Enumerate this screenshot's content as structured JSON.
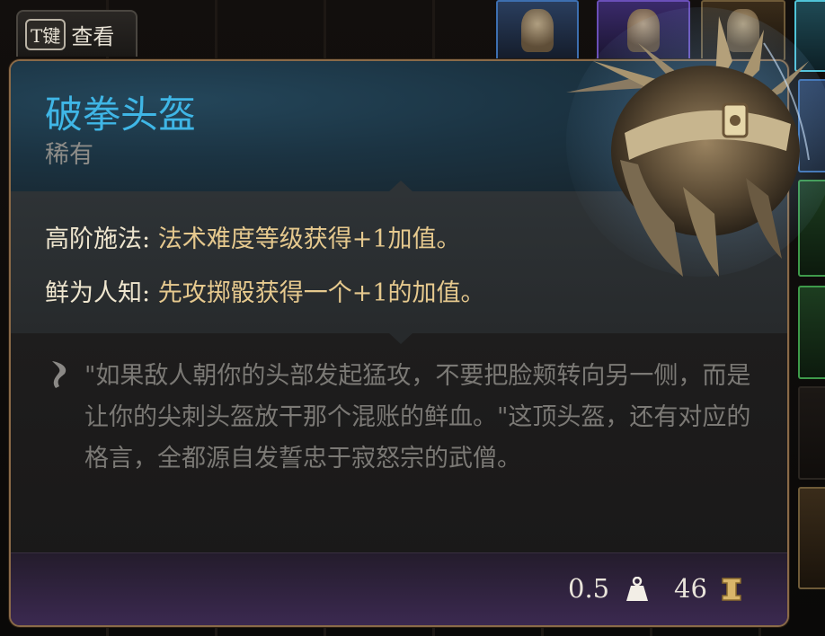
{
  "view_button": {
    "key": "T键",
    "label": "查看"
  },
  "item": {
    "name": "破拳头盔",
    "rarity": "稀有",
    "name_color": "#3fb6e6"
  },
  "properties": [
    {
      "name": "高阶施法:",
      "description": "法术难度等级获得+1加值。"
    },
    {
      "name": "鲜为人知:",
      "description": "先攻掷骰获得一个+1的加值。"
    }
  ],
  "lore": {
    "icon": "quill-icon",
    "text": "\"如果敌人朝你的头部发起猛攻，不要把脸颊转向另一侧，而是让你的尖刺头盔放干那个混账的鲜血。\"这顶头盔，还有对应的格言，全都源自发誓忠于寂怒宗的武僧。"
  },
  "stats": {
    "weight": "0.5",
    "weight_icon": "weight-icon",
    "value": "46",
    "value_icon": "gold-value-icon"
  }
}
